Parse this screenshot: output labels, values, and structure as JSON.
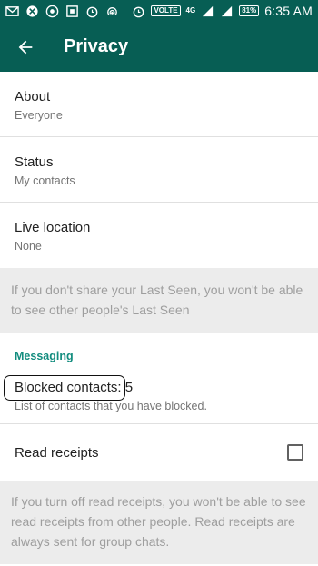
{
  "status_bar": {
    "time": "6:35 AM",
    "battery": "81%",
    "volte": "VOLTE",
    "network": "4G",
    "icons": [
      "gmail-icon",
      "app-icon",
      "chrome-icon",
      "screenshot-icon",
      "alarm-icon",
      "hotspot-icon",
      "alarm-icon",
      "signal-icon",
      "signal-icon",
      "battery-icon"
    ]
  },
  "toolbar": {
    "title": "Privacy",
    "back_icon": "arrow-left-icon"
  },
  "rows": [
    {
      "title": "About",
      "subtitle": "Everyone"
    },
    {
      "title": "Status",
      "subtitle": "My contacts"
    },
    {
      "title": "Live location",
      "subtitle": "None"
    }
  ],
  "last_seen_note": "If you don't share your Last Seen, you won't be able to see other people's Last Seen",
  "messaging": {
    "header": "Messaging",
    "blocked_title": "Blocked contacts",
    "blocked_count": ": 5",
    "blocked_subtitle": "List of contacts that you have blocked.",
    "read_receipts_label": "Read receipts",
    "read_receipts_checked": false
  },
  "read_receipts_note": "If you turn off read receipts, you won't be able to see read receipts from other people. Read receipts are always sent for group chats.",
  "colors": {
    "primary": "#075e54",
    "accent": "#128c7e"
  }
}
